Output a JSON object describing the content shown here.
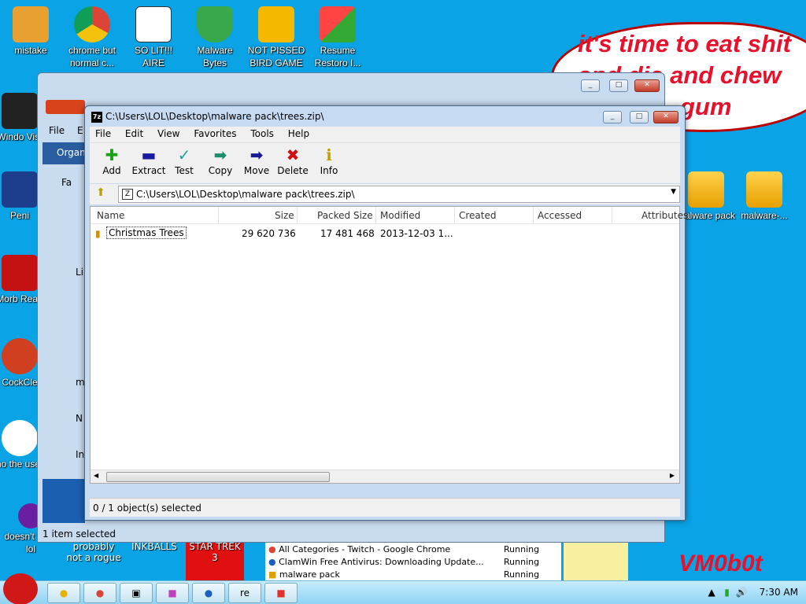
{
  "desktop": {
    "icons": [
      {
        "label": "mistake"
      },
      {
        "label": "chrome but normal c..."
      },
      {
        "label": "SO LIT!!! AIRE"
      },
      {
        "label": "Malware Bytes"
      },
      {
        "label": "NOT PISSED BIRD GAME"
      },
      {
        "label": "Resume Restoro I..."
      },
      {
        "label": "malware pack"
      },
      {
        "label": "malware-..."
      }
    ],
    "left_partial": [
      "Windo Vist",
      "Peni",
      "Morb Read",
      "CockCle",
      "who the uses t",
      "doesn't work lol",
      "probably not a rogue",
      "INKBALLS",
      "STAR TREK 3"
    ],
    "speech_lines": [
      "it's time to eat shit",
      "and die and chew",
      "gum"
    ],
    "signature": "VM0b0t"
  },
  "explorer": {
    "status": "1 item selected",
    "nav_items": [
      "Organ",
      "Fa",
      "Li",
      "m",
      "N",
      "In"
    ],
    "menu_first": [
      "File",
      "E"
    ]
  },
  "sevenzip": {
    "title": "C:\\Users\\LOL\\Desktop\\malware pack\\trees.zip\\",
    "menu": [
      "File",
      "Edit",
      "View",
      "Favorites",
      "Tools",
      "Help"
    ],
    "toolbar": [
      {
        "label": "Add",
        "icon": "plus-icon",
        "color": "#1aa01a"
      },
      {
        "label": "Extract",
        "icon": "minus-icon",
        "color": "#1a1aa0"
      },
      {
        "label": "Test",
        "icon": "check-icon",
        "color": "#20a0a0"
      },
      {
        "label": "Copy",
        "icon": "arrow-right-icon",
        "color": "#1a8f6f"
      },
      {
        "label": "Move",
        "icon": "arrow-right-icon",
        "color": "#1a1a90"
      },
      {
        "label": "Delete",
        "icon": "x-icon",
        "color": "#d01010"
      },
      {
        "label": "Info",
        "icon": "info-icon",
        "color": "#c0a000"
      }
    ],
    "address": "C:\\Users\\LOL\\Desktop\\malware pack\\trees.zip\\",
    "columns": [
      "Name",
      "Size",
      "Packed Size",
      "Modified",
      "Created",
      "Accessed",
      "Attributes"
    ],
    "rows": [
      {
        "name": "Christmas Trees",
        "size": "29 620 736",
        "packed": "17 481 468",
        "modified": "2013-12-03 1..."
      }
    ],
    "status": "0 / 1 object(s) selected"
  },
  "tasks": [
    {
      "name": "All Categories - Twitch - Google Chrome",
      "state": "Running"
    },
    {
      "name": "ClamWin Free Antivirus: Downloading Update...",
      "state": "Running"
    },
    {
      "name": "malware pack",
      "state": "Running"
    }
  ],
  "taskbar": {
    "time": "7:30 AM",
    "tb_label": "re"
  }
}
